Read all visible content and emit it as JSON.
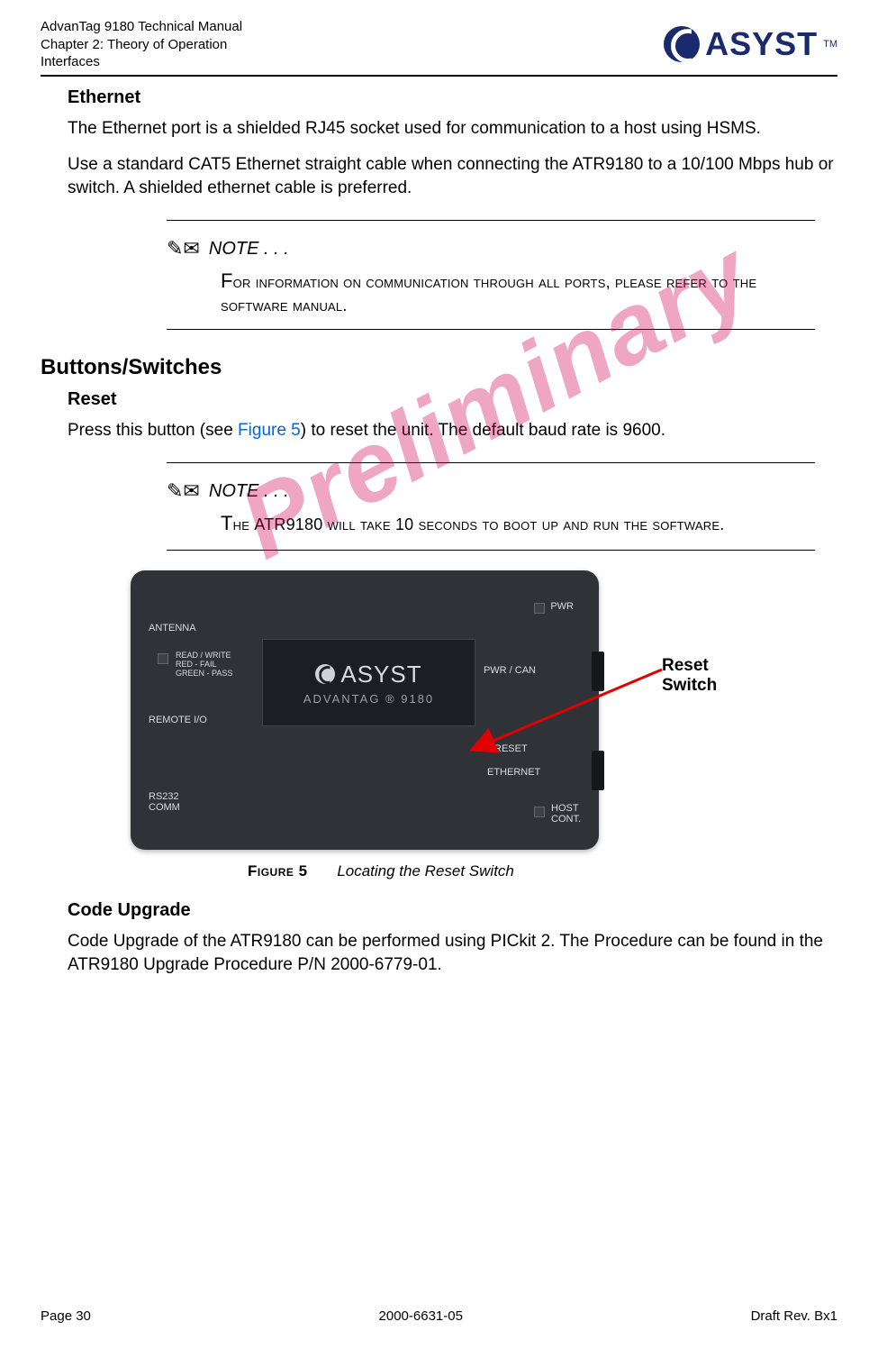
{
  "header": {
    "doc_title": "AdvanTag 9180 Technical Manual",
    "chapter": "Chapter 2: Theory of Operation",
    "section": "Interfaces",
    "brand": "ASYST",
    "tm": "TM"
  },
  "watermark": "Preliminary",
  "ethernet": {
    "heading": "Ethernet",
    "p1": "The Ethernet port is a shielded RJ45 socket used for communication to a host using HSMS.",
    "p2": "Use a standard CAT5 Ethernet straight cable when connecting the ATR9180 to a 10/100 Mbps hub or switch. A shielded ethernet cable is preferred."
  },
  "note1": {
    "label": "NOTE . . .",
    "body_pre": "F",
    "body": "or information on communication through all ports, please refer to the software manual."
  },
  "buttons_section": "Buttons/Switches",
  "reset": {
    "heading": "Reset",
    "p_pre": "Press this button (see ",
    "p_link": "Figure 5",
    "p_post": ") to reset the unit. The default baud rate is 9600."
  },
  "note2": {
    "label": "NOTE . . .",
    "body_pre": "T",
    "body_a": "he ",
    "body_model": "ATR9180",
    "body_b": " will take ",
    "body_num": "10",
    "body_c": " seconds to boot up and run the software."
  },
  "device": {
    "antenna": "ANTENNA",
    "rw": "READ / WRITE",
    "red": "RED - FAIL",
    "green": "GREEN - PASS",
    "remote": "REMOTE I/O",
    "rs232a": "RS232",
    "rs232b": "COMM",
    "pwr": "PWR",
    "pwrcan": "PWR / CAN",
    "reset": "RESET",
    "ethernet": "ETHERNET",
    "host1": "HOST",
    "host2": "CONT.",
    "brand": "ASYST",
    "model": "ADVANTAG ® 9180"
  },
  "callout": {
    "l1": "Reset",
    "l2": "Switch"
  },
  "figure": {
    "num": "Figure 5",
    "title": "Locating the Reset Switch"
  },
  "code_upgrade": {
    "heading": "Code Upgrade",
    "p": "Code Upgrade of the ATR9180 can be performed using PICkit 2. The Procedure can be found in the ATR9180 Upgrade Procedure P/N 2000-6779-01."
  },
  "footer": {
    "left": "Page 30",
    "center": "2000-6631-05",
    "right": "Draft Rev. Bx1"
  }
}
